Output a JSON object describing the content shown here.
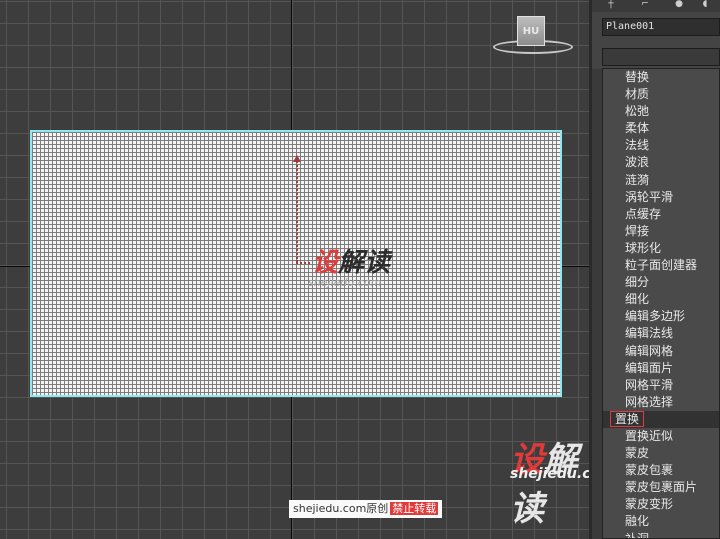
{
  "panel": {
    "object_name": "Plane001",
    "modifiers": [
      "替换",
      "材质",
      "松弛",
      "柔体",
      "法线",
      "波浪",
      "涟漪",
      "涡轮平滑",
      "点缓存",
      "焊接",
      "球形化",
      "粒子面创建器",
      "细分",
      "细化",
      "编辑多边形",
      "编辑法线",
      "编辑网格",
      "编辑面片",
      "网格平滑",
      "网格选择",
      "置换",
      "置换近似",
      "蒙皮",
      "蒙皮包裹",
      "蒙皮包裹面片",
      "蒙皮变形",
      "融化",
      "补洞"
    ],
    "selected_modifier": "置换"
  },
  "viewcube": {
    "label": "HU"
  },
  "watermarks": {
    "logo_red": "设",
    "logo_rest": "解读",
    "site": "shejiedu.com",
    "tag_prefix": "shejiedu.com原创",
    "tag_warning": "禁止转载"
  },
  "colors": {
    "selection_outline": "#8fe9f0",
    "accent_red": "#e13a3a"
  }
}
